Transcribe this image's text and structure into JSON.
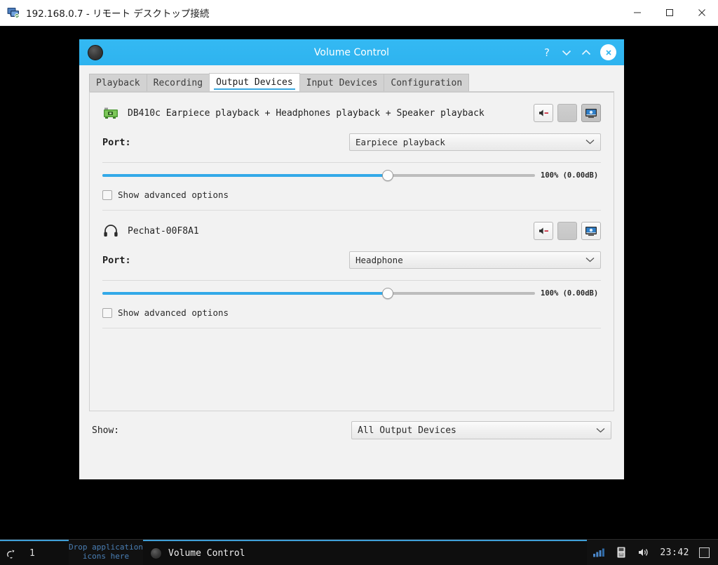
{
  "rdp": {
    "title": "192.168.0.7 - リモート デスクトップ接続",
    "icon": "remote-desktop-icon",
    "minimize": "−",
    "maximize": "□",
    "close": "×"
  },
  "window": {
    "title": "Volume Control",
    "app_icon": "volume-control-icon",
    "help_button": "?",
    "minimize_button": "⌄",
    "maximize_button": "⌃",
    "close_button": "✕"
  },
  "tabs": [
    {
      "label": "Playback",
      "active": false
    },
    {
      "label": "Recording",
      "active": false
    },
    {
      "label": "Output Devices",
      "active": true
    },
    {
      "label": "Input Devices",
      "active": false
    },
    {
      "label": "Configuration",
      "active": false
    }
  ],
  "devices": [
    {
      "icon": "sound-card-icon",
      "name": "DB410c Earpiece playback + Headphones playback + Speaker playback",
      "mute_button": "mute-icon",
      "lock_button": "lock-channels-icon",
      "default_button": "set-default-icon",
      "port_label": "Port:",
      "port_value": "Earpiece playback",
      "volume_percent": 100,
      "volume_text": "100% (0.00dB)",
      "advanced_label": "Show advanced options",
      "advanced_checked": false
    },
    {
      "icon": "headphones-icon",
      "name": "Pechat-00F8A1",
      "mute_button": "mute-icon",
      "lock_button": "lock-channels-icon",
      "default_button": "set-default-icon",
      "port_label": "Port:",
      "port_value": "Headphone",
      "volume_percent": 100,
      "volume_text": "100% (0.00dB)",
      "advanced_label": "Show advanced options",
      "advanced_checked": false
    }
  ],
  "footer": {
    "show_label": "Show:",
    "show_value": "All Output Devices"
  },
  "taskbar": {
    "pager_icon": "workspace-switcher-icon",
    "pager_number": "1",
    "drop_text": "Drop application\nicons here",
    "drop_line1": "Drop application",
    "drop_line2": "icons here",
    "task_label": "Volume Control",
    "task_icon": "volume-control-icon",
    "tray": [
      {
        "name": "network-signal-icon"
      },
      {
        "name": "usb-device-icon"
      },
      {
        "name": "volume-icon"
      }
    ],
    "clock": "23:42",
    "show_desktop": "show-desktop-button"
  },
  "colors": {
    "titlebar": "#31b6f0",
    "accent": "#33a9e8",
    "desktop": "#000000",
    "taskbar": "#111111",
    "taskbar_accent": "#3f9fd8",
    "drop_text": "#4a7fb5"
  }
}
